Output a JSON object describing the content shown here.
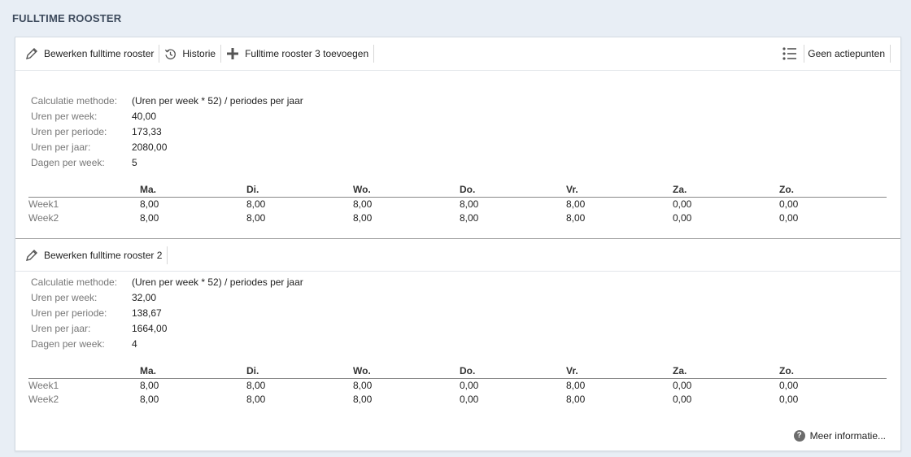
{
  "page": {
    "title": "FULLTIME ROOSTER"
  },
  "toolbar1": {
    "edit_label": "Bewerken fulltime rooster",
    "history_label": "Historie",
    "add_label": "Fulltime rooster 3 toevoegen",
    "actions_label": "Geen actiepunten"
  },
  "labels": {
    "method": "Calculatie methode:",
    "hours_week": "Uren per week:",
    "hours_period": "Uren per periode:",
    "hours_year": "Uren per jaar:",
    "days_week": "Dagen per week:"
  },
  "days": [
    "Ma.",
    "Di.",
    "Wo.",
    "Do.",
    "Vr.",
    "Za.",
    "Zo."
  ],
  "roster1": {
    "method": "(Uren per week * 52) / periodes per jaar",
    "hours_week": "40,00",
    "hours_period": "173,33",
    "hours_year": "2080,00",
    "days_week": "5",
    "weeks": [
      {
        "name": "Week1",
        "values": [
          "8,00",
          "8,00",
          "8,00",
          "8,00",
          "8,00",
          "0,00",
          "0,00"
        ]
      },
      {
        "name": "Week2",
        "values": [
          "8,00",
          "8,00",
          "8,00",
          "8,00",
          "8,00",
          "0,00",
          "0,00"
        ]
      }
    ]
  },
  "toolbar2": {
    "edit_label": "Bewerken fulltime rooster 2"
  },
  "roster2": {
    "method": "(Uren per week * 52) / periodes per jaar",
    "hours_week": "32,00",
    "hours_period": "138,67",
    "hours_year": "1664,00",
    "days_week": "4",
    "weeks": [
      {
        "name": "Week1",
        "values": [
          "8,00",
          "8,00",
          "8,00",
          "0,00",
          "8,00",
          "0,00",
          "0,00"
        ]
      },
      {
        "name": "Week2",
        "values": [
          "8,00",
          "8,00",
          "8,00",
          "0,00",
          "8,00",
          "0,00",
          "0,00"
        ]
      }
    ]
  },
  "footer": {
    "more_info": "Meer informatie..."
  }
}
